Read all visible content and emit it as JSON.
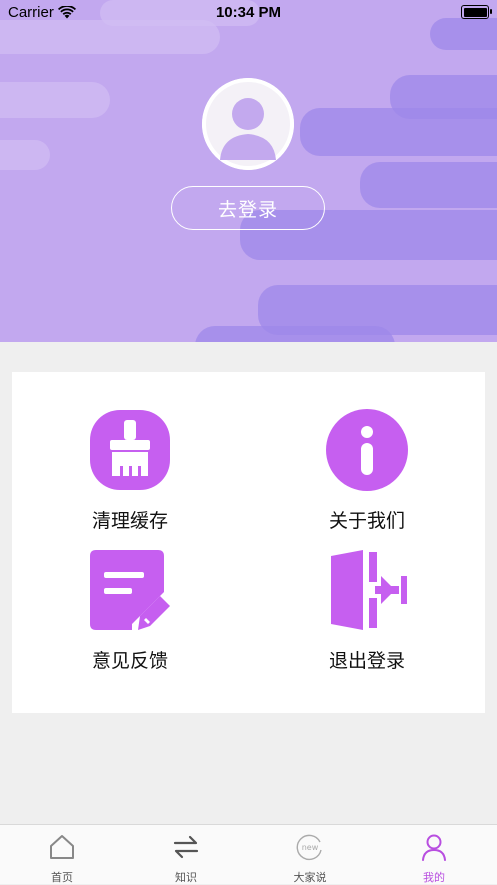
{
  "status_bar": {
    "carrier": "Carrier",
    "time": "10:34 PM"
  },
  "header": {
    "login_label": "去登录"
  },
  "menu": {
    "items": [
      {
        "label": "清理缓存",
        "icon": "broom-icon"
      },
      {
        "label": "关于我们",
        "icon": "info-icon"
      },
      {
        "label": "意见反馈",
        "icon": "feedback-edit-icon"
      },
      {
        "label": "退出登录",
        "icon": "logout-door-icon"
      }
    ]
  },
  "tabbar": {
    "tabs": [
      {
        "label": "首页",
        "icon": "home-icon"
      },
      {
        "label": "知识",
        "icon": "swap-arrows-icon"
      },
      {
        "label": "大家说",
        "icon": "new-badge-icon"
      },
      {
        "label": "我的",
        "icon": "user-icon"
      }
    ],
    "active": "我的"
  },
  "colors": {
    "header_bg": "#c2a8ef",
    "streak": "#9e88ea",
    "accent": "#c65ff0",
    "tab_active": "#b84ee0"
  }
}
